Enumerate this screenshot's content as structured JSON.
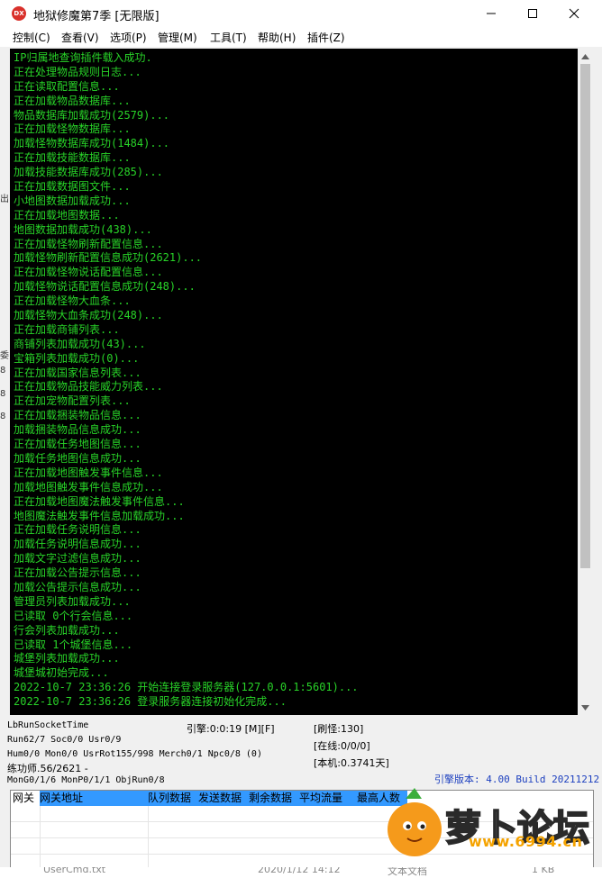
{
  "window": {
    "icon_text": "DX",
    "title": "地狱修魔第7季 [无限版]"
  },
  "menu": [
    "控制(C)",
    "查看(V)",
    "选项(P)",
    "管理(M)",
    "工具(T)",
    "帮助(H)",
    "插件(Z)"
  ],
  "console": {
    "text_color": "#28d328",
    "background": "#000000",
    "lines": [
      "IP归属地查询插件载入成功.",
      "正在处理物品规则日志...",
      "正在读取配置信息...",
      "正在加载物品数据库...",
      "物品数据库加载成功(2579)...",
      "正在加载怪物数据库...",
      "加载怪物数据库成功(1484)...",
      "正在加载技能数据库...",
      "加载技能数据库成功(285)...",
      "正在加载数据图文件...",
      "小地图数据加载成功...",
      "正在加载地图数据...",
      "地图数据加载成功(438)...",
      "正在加载怪物刷新配置信息...",
      "加载怪物刷新配置信息成功(2621)...",
      "正在加载怪物说话配置信息...",
      "加载怪物说话配置信息成功(248)...",
      "正在加载怪物大血条...",
      "加载怪物大血条成功(248)...",
      "正在加载商铺列表...",
      "商铺列表加载成功(43)...",
      "宝箱列表加载成功(0)...",
      "正在加载国家信息列表...",
      "正在加载物品技能威力列表...",
      "正在加宠物配置列表...",
      "正在加载捆装物品信息...",
      "加载捆装物品信息成功...",
      "正在加载任务地图信息...",
      "加载任务地图信息成功...",
      "正在加载地图触发事件信息...",
      "加载地图触发事件信息成功...",
      "正在加载地图魔法触发事件信息...",
      "地图魔法触发事件信息加载成功...",
      "正在加载任务说明信息...",
      "加载任务说明信息成功...",
      "加载文字过滤信息成功...",
      "正在加载公告提示信息...",
      "加载公告提示信息成功...",
      "管理员列表加载成功...",
      "已读取 0个行会信息...",
      "行会列表加载成功...",
      "已读取 1个城堡信息...",
      "城堡列表加载成功...",
      "城堡城初始完成...",
      "2022-10-7 23:36:26 开始连接登录服务器(127.0.0.1:5601)...",
      "2022-10-7 23:36:26 登录服务器连接初始化完成..."
    ]
  },
  "left_edge_chars": [
    "出",
    "委",
    "8",
    "8",
    "8"
  ],
  "status": {
    "socket": "LbRunSocketTime",
    "engine": "引擎:0:0:19 [M][F]",
    "refresh": "[刷怪:130]",
    "run": "Run62/7 Soc0/0 Usr0/9",
    "online": "[在线:0/0/0]",
    "hum": "Hum0/0 Mon0/0 UsrRot155/998 Merch0/1 Npc0/8 (0)",
    "local": "[本机:0.3741天]",
    "trainer": "练功师.56/2621 -",
    "mon": "MonG0/1/6 MonP0/1/1 ObjRun0/8",
    "version": "引擎版本: 4.00 Build 20211212"
  },
  "gateway": {
    "columns": [
      "网关",
      "网关地址",
      "队列数据",
      "发送数据",
      "剩余数据",
      "平均流量",
      "最高人数"
    ],
    "selected_index": 1,
    "row_count": 4
  },
  "background_strip": [
    "UserCmd.txt",
    "2020/1/12 14:12",
    "文本文档",
    "1 KB"
  ],
  "watermark": {
    "text": "萝卜论坛",
    "url": "www.6994.cn"
  }
}
